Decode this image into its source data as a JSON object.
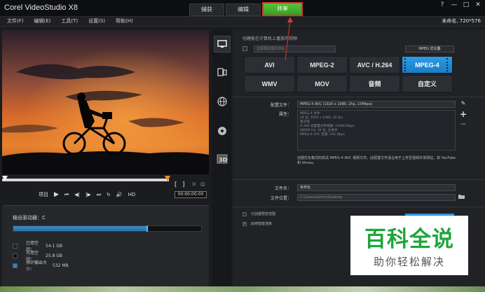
{
  "app": {
    "title": "Corel VideoStudio X8",
    "tabs": [
      {
        "label": "捕获",
        "active": false
      },
      {
        "label": "编辑",
        "active": false
      },
      {
        "label": "共享",
        "active": true
      }
    ],
    "window_controls": {
      "help": "?",
      "minimize": "—",
      "maximize": "□",
      "close": "✕"
    }
  },
  "menu": {
    "items": [
      "文件(F)",
      "编辑(E)",
      "工具(T)",
      "设置(S)",
      "帮助(H)"
    ],
    "project_info": "未命名, 720*576"
  },
  "preview": {
    "label_project": "项目",
    "timecode": "00:00:00:00",
    "controls": {
      "play": "▶",
      "home": "⏮",
      "prev_frame": "◀|",
      "next_frame": "|▶",
      "end": "⏭",
      "repeat": "↻",
      "volume": "🔊",
      "hd": "HD"
    }
  },
  "drive": {
    "label": "输出驱动器：C",
    "used_fraction": 0.71,
    "legend": [
      {
        "label": "已用空间：",
        "value": "54.1 GB",
        "color": "#1a1c20"
      },
      {
        "label": "可用空间：",
        "value": "25.8 GB",
        "color": "#0d0e10"
      },
      {
        "label": "预计输出大小：",
        "value": "532 MB",
        "color": "#2d86c8"
      }
    ]
  },
  "share": {
    "section_title": "创建能在计算机上播放的视频",
    "dropdown_placeholder": "选择要配置的项目",
    "mpeg_options_label": "MPEG 优化器",
    "formats": [
      {
        "label": "AVI",
        "selected": false
      },
      {
        "label": "MPEG-2",
        "selected": false
      },
      {
        "label": "AVC / H.264",
        "selected": false
      },
      {
        "label": "MPEG-4",
        "selected": true
      },
      {
        "label": "WMV",
        "selected": false
      },
      {
        "label": "MOV",
        "selected": false
      },
      {
        "label": "音频",
        "selected": false
      },
      {
        "label": "自定义",
        "selected": false
      }
    ],
    "profile_label": "配置文件：",
    "profile_value": "MPEG-4 AVC (1920 x 1080, 25p, 15Mbps)",
    "properties_label": "属性：",
    "properties": [
      "MPEG-4 文件",
      "24 位, 1920 x 1080, 25 fps",
      "基于帧",
      "H.264 高配置文件视频: 15000 Kbps",
      "48000 Hz, 16 位, 立体声",
      "MPEG-4 AAC 音频: 192 Kbps"
    ],
    "description": "创建优化格式的高清 MPEG-4 AVC 视频文件。此配置文件适合用于上传至视频共享网站，如 YouTube 和 Vimeo。",
    "filename_label": "文件名：",
    "filename_value": "未命名",
    "location_label": "文件位置：",
    "location_value": "C:\\Users\\admin\\Desktop",
    "options": [
      {
        "label": "只创建预览范围",
        "checked": false
      },
      {
        "label": "启用智能渲染",
        "checked": true
      }
    ]
  },
  "icons": {
    "computer": "computer-icon",
    "device": "device-icon",
    "web": "globe-icon",
    "disc": "disc-icon",
    "three_d": "3d-icon",
    "edit": "pencil-icon",
    "add": "plus-icon",
    "remove": "minus-icon",
    "folder": "folder-icon"
  },
  "watermark": {
    "main": "百科全说",
    "sub": "助你轻松解决"
  },
  "colors": {
    "accent_blue": "#1b7cc6",
    "share_green": "#3cab24",
    "highlight_red": "#d43a34"
  }
}
